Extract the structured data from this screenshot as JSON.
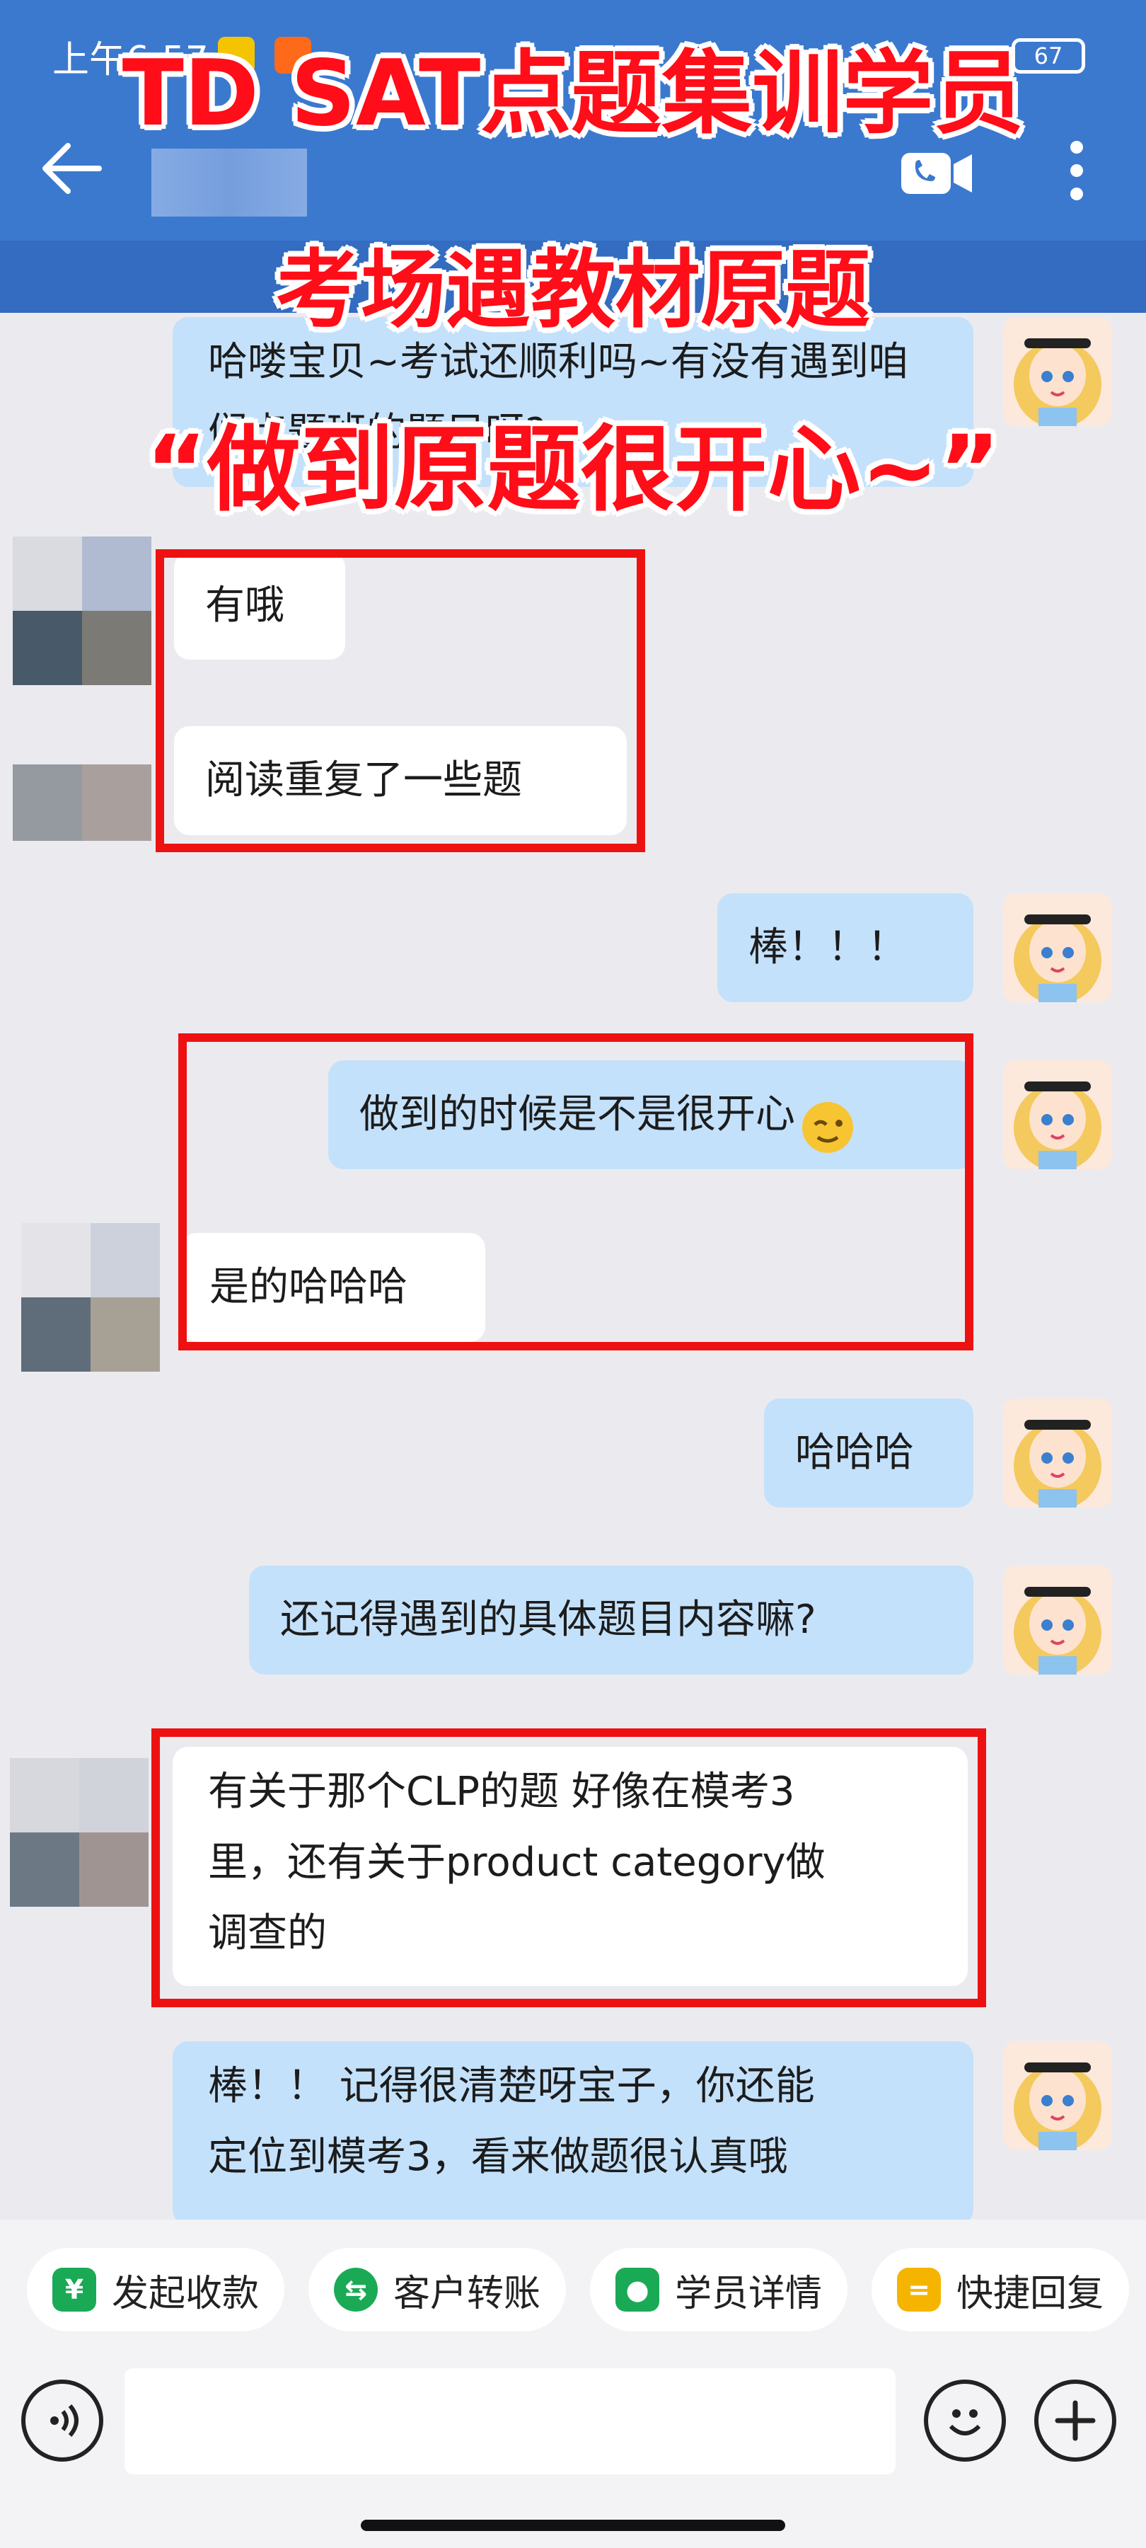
{
  "status_bar": {
    "time": "上午6:57",
    "battery": "67"
  },
  "header": {
    "back_icon": "back-arrow-icon",
    "call_icon": "video-call-icon",
    "more_icon": "more-vertical-icon"
  },
  "overlay": {
    "line1": "TD SAT点题集训学员",
    "line2": "考场遇教材原题",
    "line3": "“做到原题很开心~”"
  },
  "messages": [
    {
      "side": "out",
      "text": "哈喽宝贝~考试还顺利吗~有没有遇到咱们点题班的题目呀?"
    },
    {
      "side": "in",
      "text": "有哦"
    },
    {
      "side": "in",
      "text": "阅读重复了一些题"
    },
    {
      "side": "out",
      "text": "棒！！！"
    },
    {
      "side": "out",
      "text": "做到的时候是不是很开心"
    },
    {
      "side": "in",
      "text": "是的哈哈哈"
    },
    {
      "side": "out",
      "text": "哈哈哈"
    },
    {
      "side": "out",
      "text": "还记得遇到的具体题目内容嘛?"
    },
    {
      "side": "in",
      "text_lines": [
        "有关于那个CLP的题 好像在模考3",
        "里，还有关于product category做",
        "调查的"
      ]
    },
    {
      "side": "out",
      "text_lines": [
        "棒！！ 记得很清楚呀宝子，你还能",
        "定位到模考3，看来做题很认真哦"
      ]
    }
  ],
  "quick_actions": [
    {
      "label": "发起收款",
      "icon": "payment-shield-icon",
      "color": "#1aaa55"
    },
    {
      "label": "客户转账",
      "icon": "transfer-icon",
      "color": "#1aaa55"
    },
    {
      "label": "学员详情",
      "icon": "student-profile-icon",
      "color": "#1aaa55"
    },
    {
      "label": "快捷回复",
      "icon": "quick-reply-icon",
      "color": "#f5b400"
    }
  ],
  "input": {
    "value": "",
    "placeholder": ""
  },
  "colors": {
    "header": "#3b79cf",
    "incoming": "#ffffff",
    "outgoing": "#c4e1fb",
    "highlight_box": "#ee1111",
    "overlay_text": "#ff0d18"
  }
}
